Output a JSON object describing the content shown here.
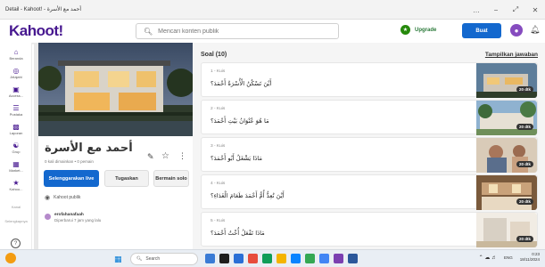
{
  "window": {
    "title": "Detail - Kahoot! - أحمد مع الأسرة",
    "controls": [
      "…",
      "−",
      "⤢",
      "✕"
    ]
  },
  "header": {
    "logo": "Kahoot!",
    "search_placeholder": "Mencari konten publik",
    "upgrade_label": "Upgrade",
    "create_label": "Buat"
  },
  "nav": {
    "items": [
      {
        "label": "Beranda",
        "icon": "home-icon"
      },
      {
        "label": "Jelajahi",
        "icon": "compass-icon"
      },
      {
        "label": "Access...",
        "icon": "access-icon"
      },
      {
        "label": "Pustaka",
        "icon": "library-icon"
      },
      {
        "label": "Laporan",
        "icon": "reports-icon"
      },
      {
        "label": "Grup",
        "icon": "groups-icon"
      },
      {
        "label": "Market...",
        "icon": "marketplace-icon"
      },
      {
        "label": "Kahoo...",
        "icon": "kahoot-academy-icon"
      }
    ],
    "muted_items": [
      "Kanal",
      "Selengkapnya"
    ]
  },
  "kahoot": {
    "title": "أحمد مع الأسرة",
    "meta": "0 kali dimainkan • 0 pemain",
    "host_live": "Selenggarakan live",
    "assign": "Tugaskan",
    "play_solo": "Bermain solo",
    "visibility": "Kahoot publik",
    "creator": "erofahanafaah",
    "updated": "Diperbarui 7 jam yang lalu"
  },
  "questions_panel": {
    "heading": "Soal (10)",
    "show_answers": "Tampilkan jawaban",
    "items": [
      {
        "type": "1 - Kuis",
        "text": "أَيْنَ تَسْكُنُ الْأُسْرَةُ أَحْمَدَ؟",
        "time": "20 dtk"
      },
      {
        "type": "2 - Kuis",
        "text": "مَا هُوَ عُنْوَانُ بَيْتِ أَحْمَدَ؟",
        "time": "20 dtk"
      },
      {
        "type": "3 - Kuis",
        "text": "مَاذَا يَشْغَلُ أَبُو أَحْمَدَ؟",
        "time": "20 dtk"
      },
      {
        "type": "4 - Kuis",
        "text": "أَيْنَ تُعِدُّ أُمُّ أَحْمَدَ طَعَامَ الْغَدَاءِ؟",
        "time": "20 dtk"
      },
      {
        "type": "5 - Kuis",
        "text": "مَاذَا تَفْعَلُ أُخْتُ أَحْمَدَ؟",
        "time": "20 dtk"
      }
    ]
  },
  "taskbar": {
    "search": "Search",
    "lang": "ENG",
    "time": "0:23",
    "date": "18/11/2024"
  },
  "colors": {
    "brand": "#46178f",
    "primary": "#1368ce",
    "upgrade": "#26890c"
  }
}
